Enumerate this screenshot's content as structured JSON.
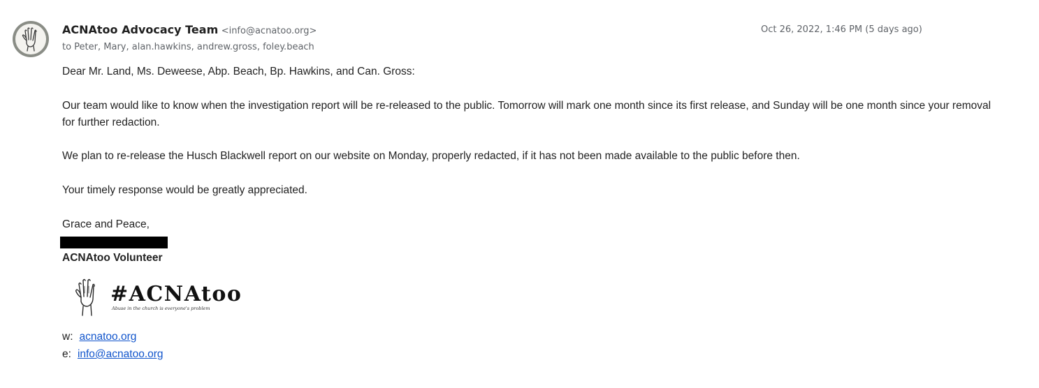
{
  "message": {
    "sender_name": "ACNAtoo Advocacy Team",
    "sender_email": "<info@acnatoo.org>",
    "timestamp": "Oct 26, 2022, 1:46 PM (5 days ago)",
    "recipients": "to Peter, Mary, alan.hawkins, andrew.gross, foley.beach"
  },
  "body": {
    "greeting": "Dear Mr. Land, Ms. Deweese, Abp. Beach, Bp. Hawkins, and Can. Gross:",
    "paragraph1": "Our team would like to know when the investigation report will be re-released to the public. Tomorrow will mark one month since its first release, and Sunday will be one month since your removal for further redaction.",
    "paragraph2": "We plan to re-release the Husch Blackwell report on our website on Monday, properly redacted, if it has not been made available to the public before then.",
    "paragraph3": "Your timely response would be greatly appreciated.",
    "closing": "Grace and Peace,"
  },
  "signature": {
    "role": "ACNAtoo Volunteer",
    "logo_text": "#ACNAtoo",
    "logo_tagline": "Abuse in the church is everyone's problem",
    "web_label": "w:",
    "web_link": "acnatoo.org",
    "email_label": "e:",
    "email_link": "info@acnatoo.org"
  },
  "icons": {
    "avatar": "raised-hand-icon",
    "logo": "raised-hand-icon"
  },
  "colors": {
    "link": "#1155cc",
    "redaction": "#000000",
    "meta_text": "#5f6368"
  }
}
